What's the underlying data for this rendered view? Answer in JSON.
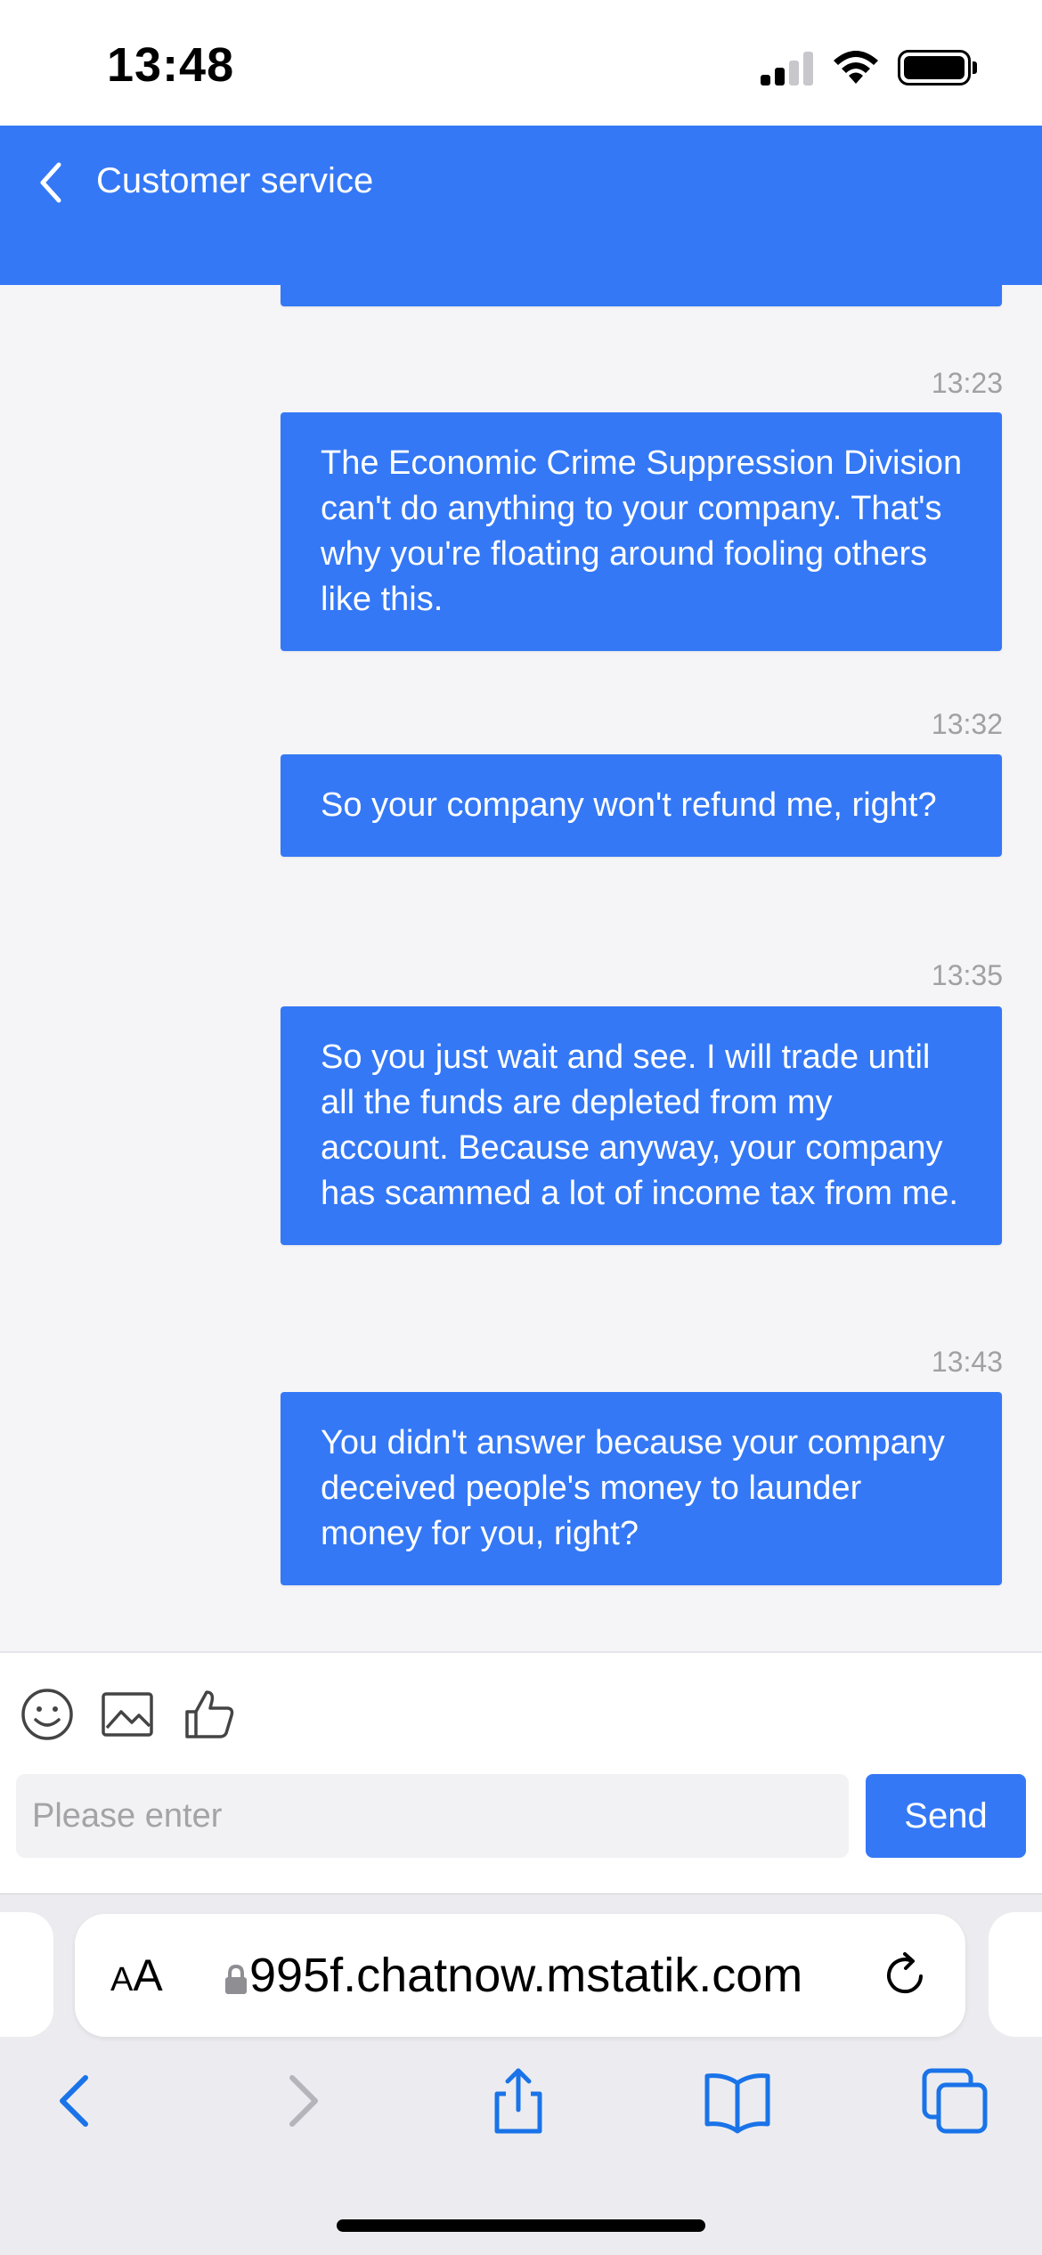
{
  "status_bar": {
    "time": "13:48"
  },
  "header": {
    "title": "Customer service"
  },
  "messages": [
    {
      "time": "13:23",
      "text": "The Economic Crime Suppression Division can't do anything to your company. That's why you're floating around fooling others like this."
    },
    {
      "time": "13:32",
      "text": "So your company won't refund me, right?"
    },
    {
      "time": "13:35",
      "text": "So you just wait and see. I will trade until all the funds are depleted from my account. Because anyway, your company has scammed a lot of income tax from me."
    },
    {
      "time": "13:43",
      "text": "You didn't answer because your company deceived people's money to launder money for you, right?"
    }
  ],
  "composer": {
    "placeholder": "Please enter",
    "send_label": "Send"
  },
  "browser": {
    "text_size_small": "A",
    "text_size_large": "A",
    "url": "995f.chatnow.mstatik.com"
  },
  "colors": {
    "accent": "#3478f6",
    "timestamp": "#a0a0a5",
    "safari_blue": "#1a73e8"
  },
  "icons": [
    "back-chevron-icon",
    "emoji-icon",
    "image-icon",
    "thumbs-up-icon",
    "lock-icon",
    "reload-icon",
    "back-icon",
    "forward-icon",
    "share-icon",
    "bookmarks-icon",
    "tabs-icon"
  ]
}
